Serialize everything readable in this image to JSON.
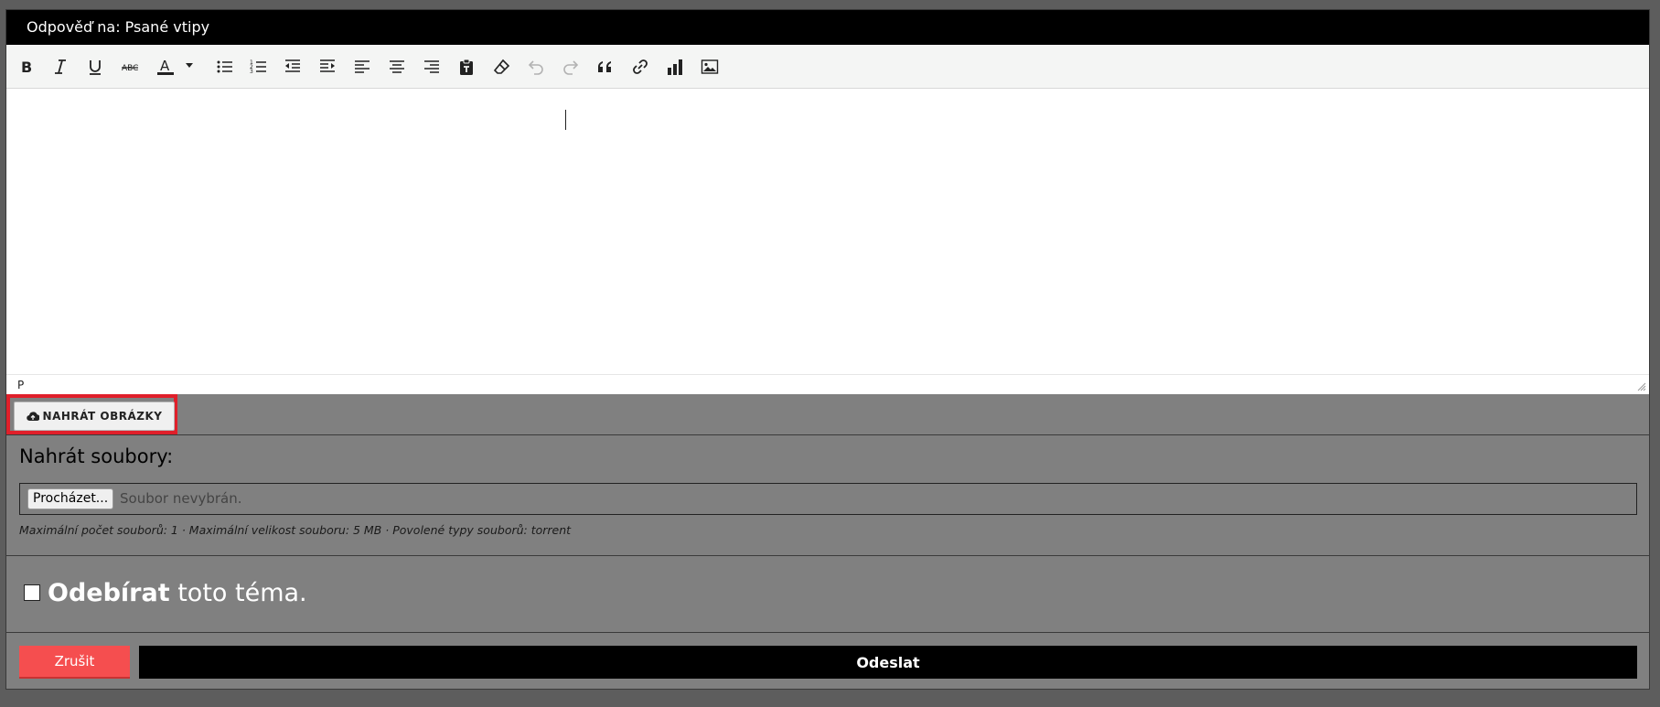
{
  "window": {
    "title": "Odpověď na: Psané vtipy"
  },
  "toolbar": {
    "buttons": [
      {
        "name": "bold-icon"
      },
      {
        "name": "italic-icon"
      },
      {
        "name": "underline-icon"
      },
      {
        "name": "strikethrough-icon"
      },
      {
        "name": "font-color-icon"
      },
      {
        "name": "bullet-list-icon"
      },
      {
        "name": "numbered-list-icon"
      },
      {
        "name": "outdent-icon"
      },
      {
        "name": "indent-icon"
      },
      {
        "name": "align-left-icon"
      },
      {
        "name": "align-center-icon"
      },
      {
        "name": "align-right-icon"
      },
      {
        "name": "paste-text-icon"
      },
      {
        "name": "clear-format-icon"
      },
      {
        "name": "undo-icon"
      },
      {
        "name": "redo-icon"
      },
      {
        "name": "blockquote-icon"
      },
      {
        "name": "link-icon"
      },
      {
        "name": "chart-icon"
      },
      {
        "name": "image-icon"
      }
    ],
    "strike_label": "ABC",
    "color_label": "A"
  },
  "editor": {
    "content": "",
    "path": "P"
  },
  "upload_images": {
    "label": "NAHRÁT OBRÁZKY",
    "icon": "cloud-upload-icon"
  },
  "files": {
    "title": "Nahrát soubory:",
    "browse_label": "Procházet...",
    "status": "Soubor nevybrán.",
    "note": "Maximální počet souborů: 1 · Maximální velikost souboru: 5 MB · Povolené typy souborů: torrent"
  },
  "subscribe": {
    "bold": "Odebírat",
    "rest": " toto téma.",
    "checked": false
  },
  "actions": {
    "cancel_label": "Zrušit",
    "send_label": "Odeslat"
  },
  "colors": {
    "cancel": "#f54e4f",
    "send": "#000000",
    "highlight": "#e01f2a",
    "panel": "#808080"
  }
}
